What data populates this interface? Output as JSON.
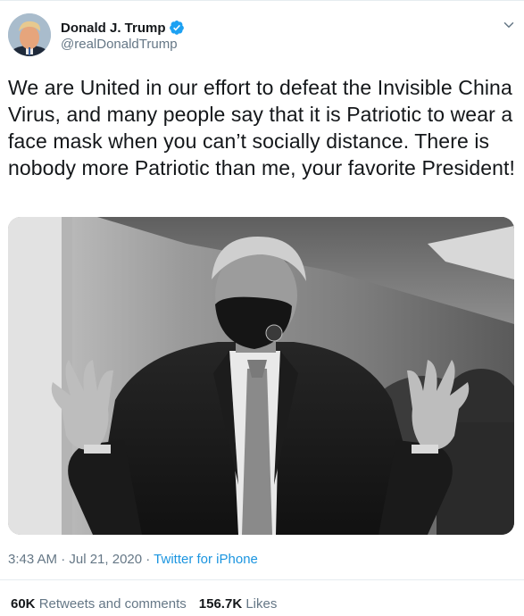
{
  "tweet": {
    "author": {
      "display_name": "Donald J. Trump",
      "handle": "@realDonaldTrump",
      "verified": true
    },
    "text": "We are United in our effort to defeat the Invisible China Virus, and many people say that it is Patriotic to wear a face mask when you can’t socially distance. There is nobody more Patriotic than me, your favorite President!",
    "timestamp": "3:43 AM · Jul 21, 2020 · ",
    "source": "Twitter for iPhone",
    "stats": {
      "retweets_count": "60K",
      "retweets_label": "Retweets and comments",
      "likes_count": "156.7K",
      "likes_label": "Likes"
    }
  },
  "colors": {
    "text_primary": "#14171a",
    "text_secondary": "#657786",
    "link_blue": "#1b95e0",
    "verified_blue": "#1da1f2",
    "divider": "#e6ecf0"
  },
  "icons": {
    "verified": "verified-badge-icon",
    "menu": "chevron-down-icon"
  }
}
